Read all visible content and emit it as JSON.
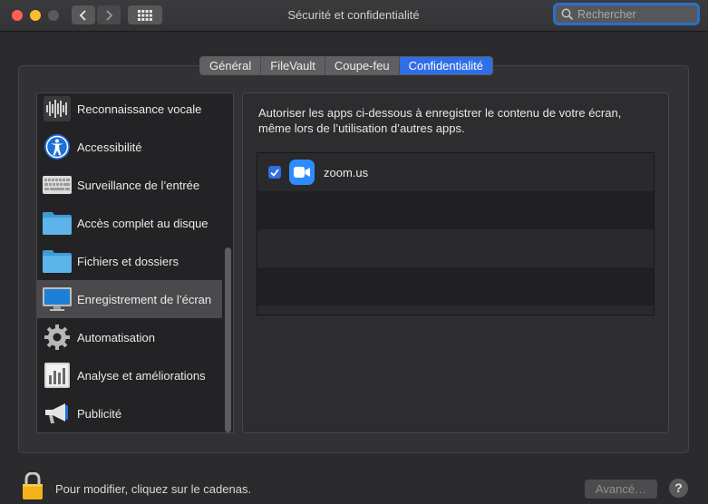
{
  "window": {
    "title": "Sécurité et confidentialité",
    "search_placeholder": "Rechercher"
  },
  "tabs": [
    {
      "label": "Général",
      "active": false
    },
    {
      "label": "FileVault",
      "active": false
    },
    {
      "label": "Coupe-feu",
      "active": false
    },
    {
      "label": "Confidentialité",
      "active": true
    }
  ],
  "sidebar": {
    "items": [
      {
        "label": "Reconnaissance vocale",
        "icon": "waveform-icon"
      },
      {
        "label": "Accessibilité",
        "icon": "accessibility-icon"
      },
      {
        "label": "Surveillance de l’entrée",
        "icon": "keyboard-icon"
      },
      {
        "label": "Accès complet au disque",
        "icon": "folder-icon"
      },
      {
        "label": "Fichiers et dossiers",
        "icon": "folder-icon"
      },
      {
        "label": "Enregistrement de l’écran",
        "icon": "display-icon",
        "selected": true
      },
      {
        "label": "Automatisation",
        "icon": "gear-icon"
      },
      {
        "label": "Analyse et améliorations",
        "icon": "chart-icon"
      },
      {
        "label": "Publicité",
        "icon": "megaphone-icon"
      }
    ]
  },
  "content": {
    "description": "Autoriser les apps ci-dessous à enregistrer le contenu de votre écran, même lors de l’utilisation d’autres apps.",
    "apps": [
      {
        "name": "zoom.us",
        "checked": true,
        "icon": "zoom-icon"
      }
    ]
  },
  "footer": {
    "lock_text": "Pour modifier, cliquez sur le cadenas.",
    "advanced_label": "Avancé…",
    "help_label": "?"
  },
  "colors": {
    "accent": "#2f6ee6",
    "zoom": "#2d8cff"
  }
}
